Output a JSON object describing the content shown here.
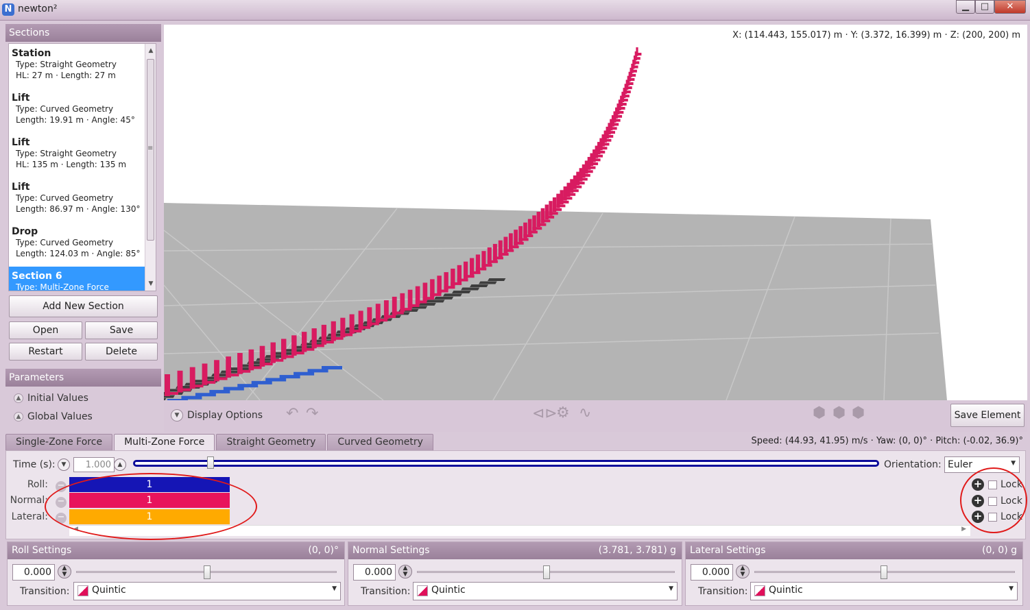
{
  "app": {
    "logo": "N",
    "title": "newton²"
  },
  "window_buttons": {
    "minimize": "▁",
    "maximize": "□",
    "close": "✕"
  },
  "sections": {
    "header": "Sections",
    "items": [
      {
        "title": "Station",
        "line1": "Type: Straight Geometry",
        "line2": "HL: 27 m · Length: 27 m"
      },
      {
        "title": "Lift",
        "line1": "Type: Curved Geometry",
        "line2": "Length: 19.91 m · Angle: 45°"
      },
      {
        "title": "Lift",
        "line1": "Type: Straight Geometry",
        "line2": "HL: 135 m · Length: 135 m"
      },
      {
        "title": "Lift",
        "line1": "Type: Curved Geometry",
        "line2": "Length: 86.97 m · Angle: 130°"
      },
      {
        "title": "Drop",
        "line1": "Type: Curved Geometry",
        "line2": "Length: 124.03 m · Angle: 85°"
      },
      {
        "title": "Section 6",
        "line1": "Type: Multi-Zone Force",
        "line2": ""
      }
    ],
    "add_button": "Add New Section",
    "open_button": "Open",
    "save_button": "Save",
    "restart_button": "Restart",
    "delete_button": "Delete"
  },
  "parameters": {
    "header": "Parameters",
    "initial_values": "Initial Values",
    "global_values": "Global Values"
  },
  "viewport": {
    "coords": "X: (114.443, 155.017) m  ·  Y: (3.372, 16.399) m  ·  Z: (200, 200) m"
  },
  "toolbar": {
    "display_options": "Display Options",
    "save_element": "Save Element"
  },
  "tabs": [
    {
      "label": "Single-Zone Force"
    },
    {
      "label": "Multi-Zone Force"
    },
    {
      "label": "Straight Geometry"
    },
    {
      "label": "Curved Geometry"
    }
  ],
  "status": {
    "speed": "Speed: (44.93, 41.95) m/s · Yaw: (0, 0)° · Pitch: (-0.02, 36.9)°"
  },
  "zone": {
    "time_label": "Time (s):",
    "time_value": "1.000",
    "orientation_label": "Orientation:",
    "orientation_value": "Euler",
    "rows": [
      {
        "label": "Roll:",
        "value": "1",
        "color": "#1515b5"
      },
      {
        "label": "Normal:",
        "value": "1",
        "color": "#e8145c"
      },
      {
        "label": "Lateral:",
        "value": "1",
        "color": "#ffaa00"
      }
    ],
    "lock_label": "Lock"
  },
  "settings": [
    {
      "title": "Roll Settings",
      "value": "(0, 0)°",
      "number": "0.000",
      "transition_label": "Transition:",
      "transition": "Quintic"
    },
    {
      "title": "Normal Settings",
      "value": "(3.781, 3.781) g",
      "number": "0.000",
      "transition_label": "Transition:",
      "transition": "Quintic"
    },
    {
      "title": "Lateral Settings",
      "value": "(0, 0) g",
      "number": "0.000",
      "transition_label": "Transition:",
      "transition": "Quintic"
    }
  ],
  "colors": {
    "track_pink": "#d81b60",
    "track_blue": "#2f5fd0",
    "annotation_red": "#e01a1a"
  }
}
